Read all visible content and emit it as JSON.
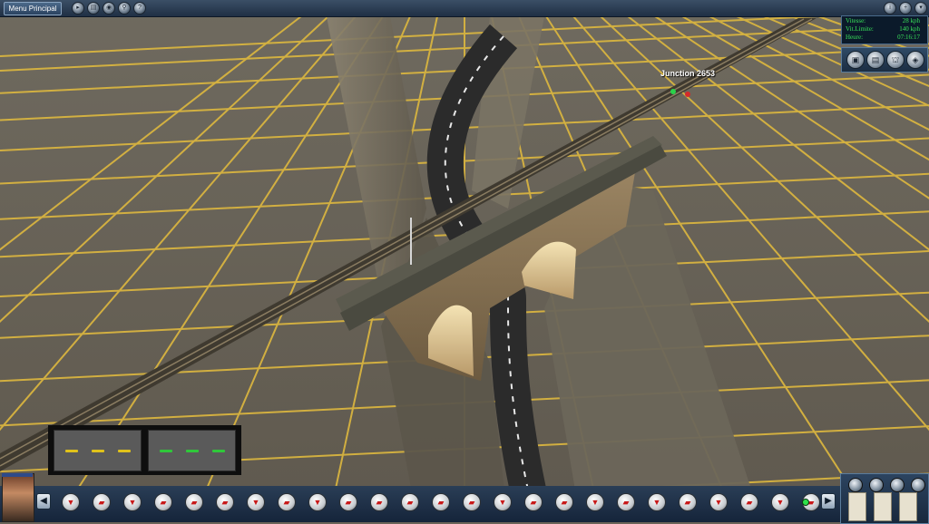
{
  "topbar": {
    "menu_label": "Menu Principal",
    "icons": [
      "play-icon",
      "film-icon",
      "camera-icon",
      "search-icon",
      "help-icon"
    ],
    "icon_glyphs": [
      "▸",
      "▤",
      "◉",
      "⚲",
      "?"
    ],
    "window_icons": [
      "info-icon",
      "minimize-icon",
      "maximize-icon"
    ],
    "window_glyphs": [
      "i",
      "+",
      "▾"
    ]
  },
  "hud": {
    "speed_label": "Vitesse:",
    "speed_value": "28 kph",
    "limit_label": "Vit.Limite:",
    "limit_value": "140 kph",
    "time_label": "Heure:",
    "time_value": "07:16:17",
    "buttons": [
      "driver-view-icon",
      "cab-view-icon",
      "external-view-icon",
      "track-view-icon"
    ],
    "button_glyphs": [
      "▣",
      "▤",
      "⛫",
      "◈"
    ]
  },
  "scene": {
    "junction_label": "Junction 2653"
  },
  "swatches": {
    "left_color": "#e0c21a",
    "right_color": "#2fc83a"
  },
  "toolbar": {
    "tools": [
      "down",
      "train",
      "down",
      "train",
      "train",
      "train",
      "down",
      "train",
      "down",
      "train",
      "train",
      "train",
      "train",
      "train",
      "down",
      "train",
      "train",
      "down",
      "train",
      "down",
      "train",
      "down",
      "train",
      "down",
      "train"
    ],
    "left_arrow": "◀",
    "right_arrow": "▶"
  },
  "right_panel": {
    "buttons": [
      "tools-icon",
      "settings-icon",
      "back-icon",
      "bridge-icon"
    ]
  }
}
